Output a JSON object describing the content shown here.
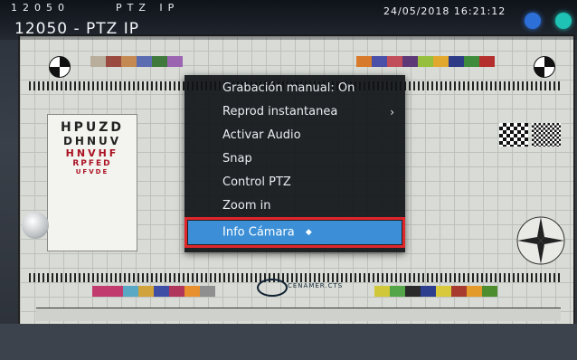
{
  "osd": {
    "camera_id": "12050",
    "mode_label": "PTZ IP",
    "camera_name": "12050 - PTZ IP",
    "timestamp": "24/05/2018 16:21:12"
  },
  "chart_logo_text": "CENAMER.CTS",
  "eye_chart": [
    "HPUZD",
    "DHNUV",
    "HNVHF",
    "RPFED",
    "UFVDE"
  ],
  "context_menu": {
    "items": [
      {
        "label": "Grabación manual: On",
        "has_submenu": false
      },
      {
        "label": "Reprod instantanea",
        "has_submenu": true
      },
      {
        "label": "Activar Audio",
        "has_submenu": false
      },
      {
        "label": "Snap",
        "has_submenu": false
      },
      {
        "label": "Control PTZ",
        "has_submenu": false
      },
      {
        "label": "Zoom in",
        "has_submenu": false
      },
      {
        "label": "Info Cámara",
        "has_submenu": false,
        "selected": true
      }
    ],
    "submenu_arrow": "›"
  },
  "colors": {
    "menu_bg": "#101216",
    "selected_bg": "#3c8fd6",
    "highlight_border": "#e0262b",
    "status_dot_1": "#2d6fd8",
    "status_dot_2": "#1fc3b6"
  },
  "icons": [
    "status-dot-blue-icon",
    "status-dot-teal-icon",
    "submenu-arrow-icon",
    "mouse-cursor-icon"
  ]
}
